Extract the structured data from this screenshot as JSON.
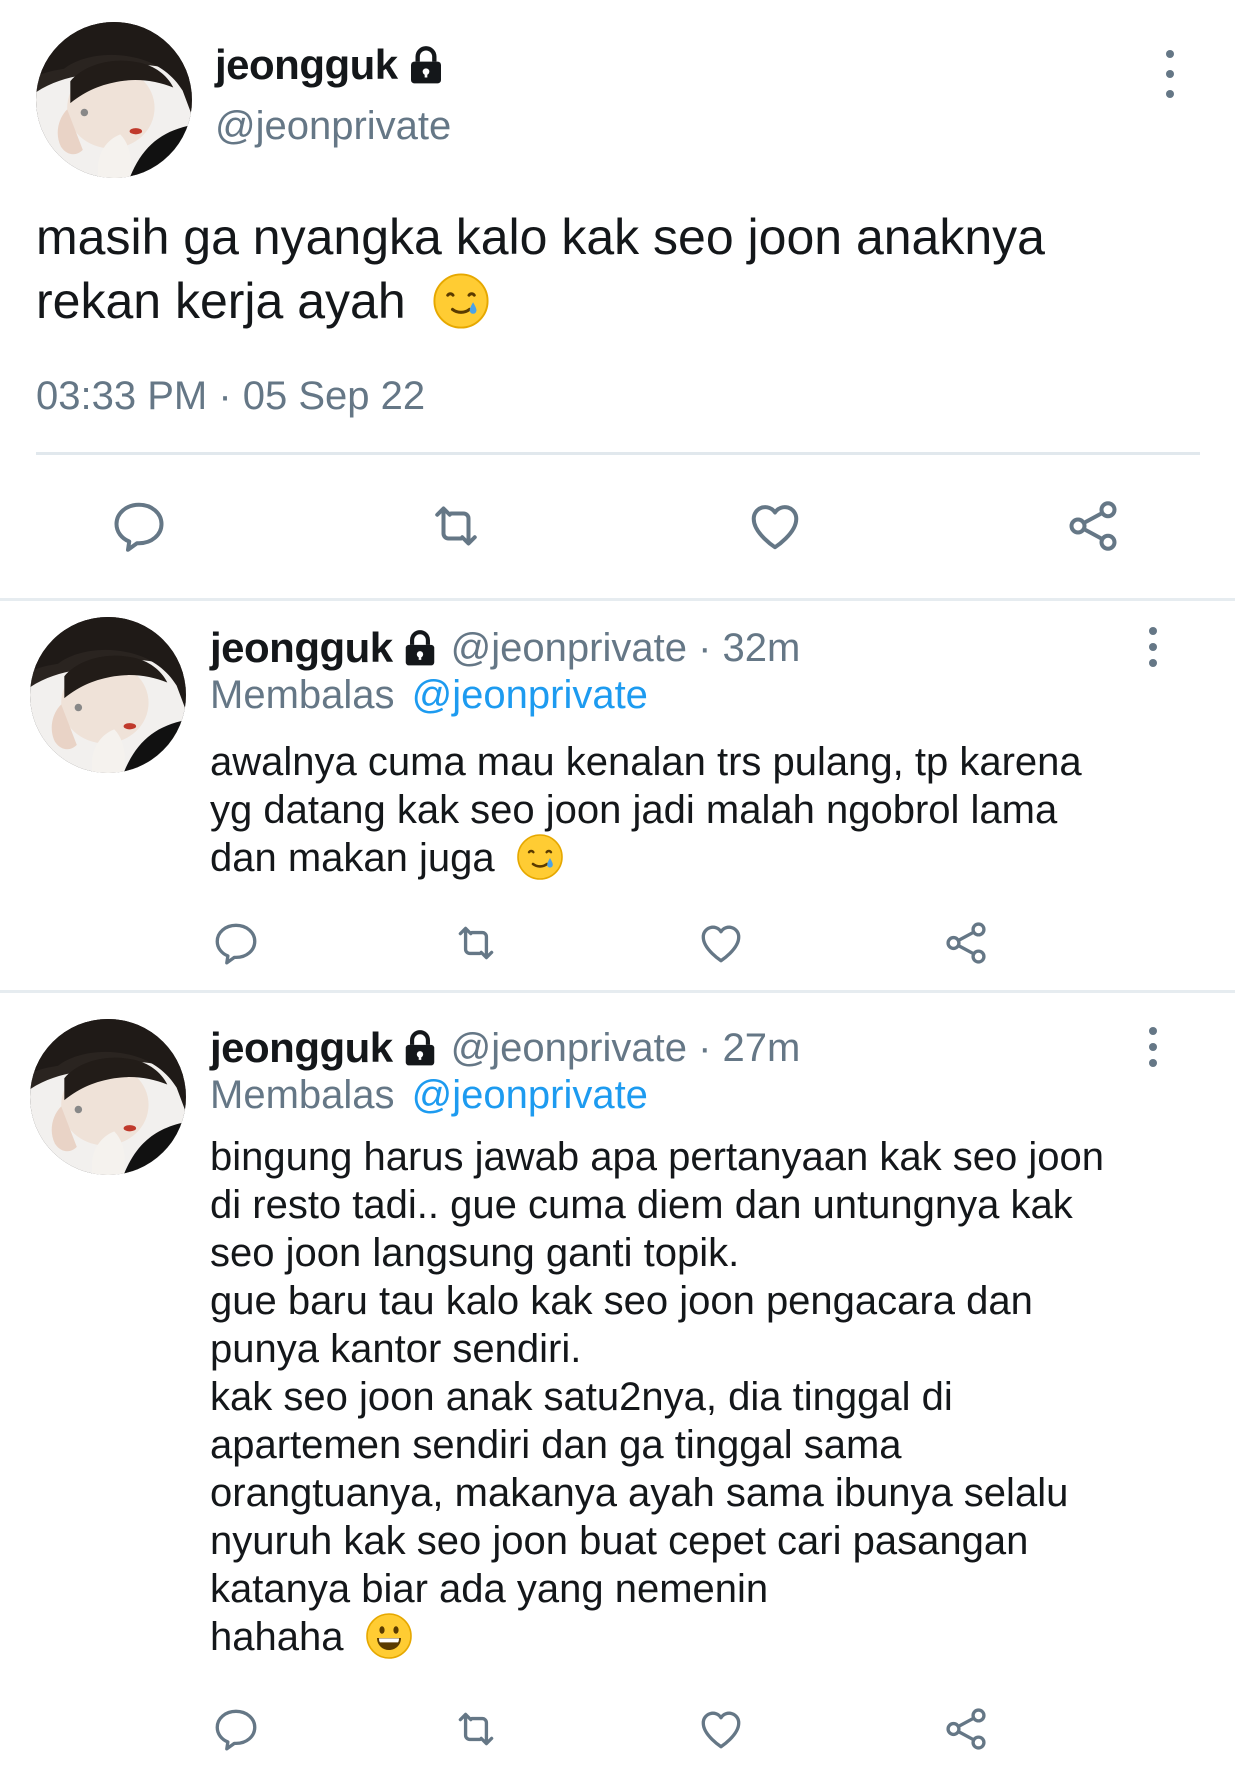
{
  "main_tweet": {
    "display_name": "jeongguk",
    "handle": "@jeonprivate",
    "text_line1": "masih ga nyangka kalo kak seo joon anaknya",
    "text_line2": "rekan kerja ayah",
    "emoji": "crying-smile",
    "timestamp": "03:33 PM · 05 Sep 22"
  },
  "replies": [
    {
      "display_name": "jeongguk",
      "handle": "@jeonprivate",
      "dot": " · ",
      "time": "32m",
      "reply_prefix": "Membalas",
      "reply_to": "@jeonprivate",
      "lines": [
        "awalnya cuma mau kenalan trs pulang, tp karena",
        "yg datang kak seo joon jadi malah ngobrol lama",
        "dan makan juga"
      ],
      "emoji": "crying-smile"
    },
    {
      "display_name": "jeongguk",
      "handle": "@jeonprivate",
      "dot": " · ",
      "time": "27m",
      "reply_prefix": "Membalas",
      "reply_to": "@jeonprivate",
      "lines": [
        "bingung harus jawab apa pertanyaan kak seo joon",
        "di resto tadi.. gue cuma diem dan untungnya kak",
        "seo joon langsung ganti topik.",
        "gue baru tau kalo kak seo joon pengacara dan",
        "punya kantor sendiri.",
        "kak seo joon anak satu2nya, dia tinggal di",
        "apartemen sendiri dan ga tinggal sama",
        "orangtuanya, makanya ayah sama ibunya selalu",
        "nyuruh kak seo joon buat cepet cari pasangan",
        "katanya biar ada yang nemenin",
        "hahaha"
      ],
      "emoji": "grinning-face"
    }
  ],
  "icons": {
    "reply": "reply-icon",
    "retweet": "retweet-icon",
    "like": "like-icon",
    "share": "share-icon",
    "lock": "lock-icon",
    "more": "more-options-icon"
  },
  "colors": {
    "text": "#14171a",
    "secondary": "#657786",
    "link": "#1d9bf0",
    "divider": "#e6ecf0"
  }
}
